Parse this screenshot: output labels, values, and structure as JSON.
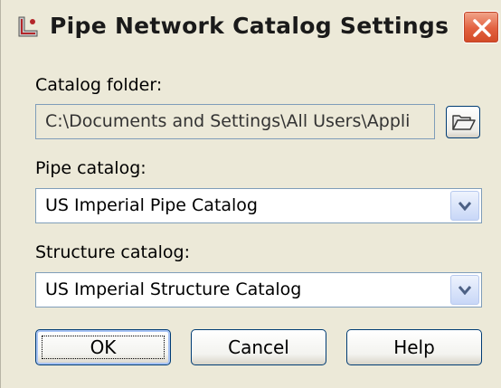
{
  "window": {
    "title": "Pipe Network Catalog Settings",
    "icon": "pipe-network-app-icon",
    "close_icon": "close-icon"
  },
  "catalog_folder": {
    "label": "Catalog folder:",
    "value": "C:\\Documents and Settings\\All Users\\Appli",
    "browse_icon": "folder-open-icon"
  },
  "pipe_catalog": {
    "label": "Pipe catalog:",
    "selected": "US Imperial Pipe Catalog"
  },
  "structure_catalog": {
    "label": "Structure catalog:",
    "selected": "US Imperial Structure Catalog"
  },
  "buttons": {
    "ok": "OK",
    "cancel": "Cancel",
    "help": "Help"
  },
  "colors": {
    "dialog_bg": "#ece9d8",
    "close_button": "#e2603f",
    "field_border": "#7f9db9",
    "button_border": "#003c74"
  }
}
